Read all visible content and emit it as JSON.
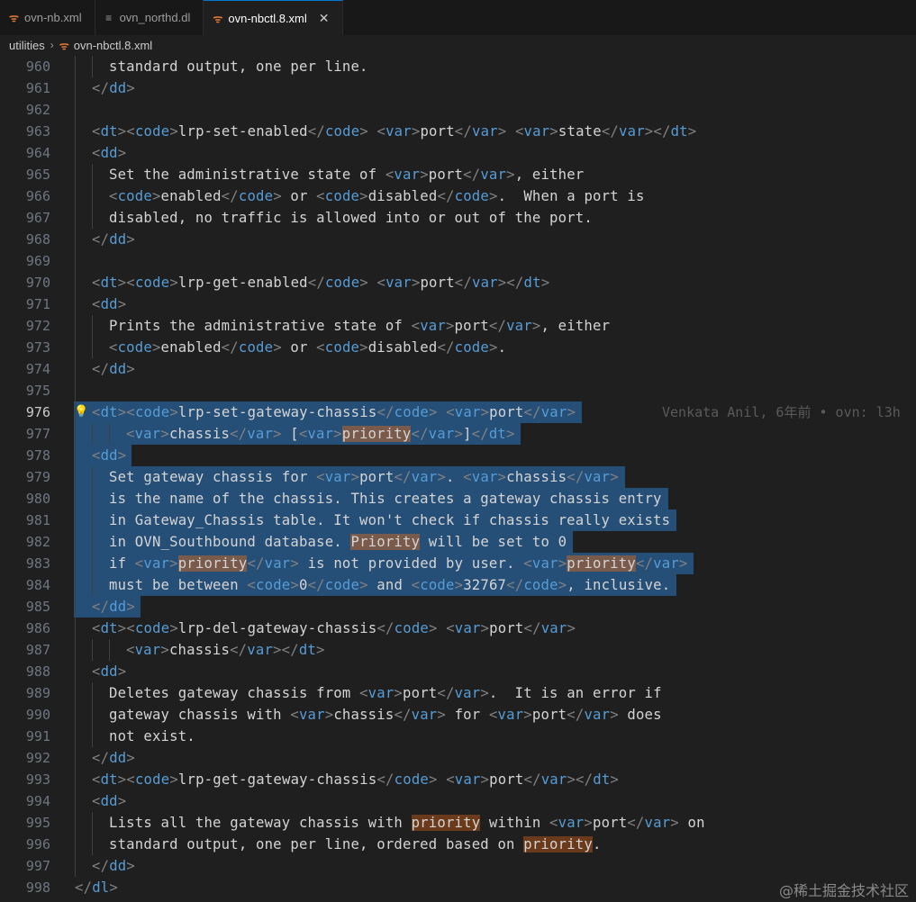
{
  "tabs": [
    {
      "label": "ovn-nb.xml",
      "icon": "rss-icon",
      "active": false
    },
    {
      "label": "ovn_northd.dl",
      "icon": "lines-icon",
      "active": false
    },
    {
      "label": "ovn-nbctl.8.xml",
      "icon": "rss-icon",
      "active": true
    }
  ],
  "breadcrumb": {
    "folder": "utilities",
    "file": "ovn-nbctl.8.xml"
  },
  "blame": "Venkata Anil, 6年前 • ovn: l3h",
  "watermark": "@稀土掘金技术社区",
  "lines": [
    {
      "n": "960",
      "text": "standard output, one per line."
    },
    {
      "n": "961",
      "text": "</dd>"
    },
    {
      "n": "962",
      "text": ""
    },
    {
      "n": "963",
      "text": "<dt><code>lrp-set-enabled</code> <var>port</var> <var>state</var></dt>"
    },
    {
      "n": "964",
      "text": "<dd>"
    },
    {
      "n": "965",
      "text": "Set the administrative state of <var>port</var>, either"
    },
    {
      "n": "966",
      "text": "<code>enabled</code> or <code>disabled</code>.  When a port is"
    },
    {
      "n": "967",
      "text": "disabled, no traffic is allowed into or out of the port."
    },
    {
      "n": "968",
      "text": "</dd>"
    },
    {
      "n": "969",
      "text": ""
    },
    {
      "n": "970",
      "text": "<dt><code>lrp-get-enabled</code> <var>port</var></dt>"
    },
    {
      "n": "971",
      "text": "<dd>"
    },
    {
      "n": "972",
      "text": "Prints the administrative state of <var>port</var>, either"
    },
    {
      "n": "973",
      "text": "<code>enabled</code> or <code>disabled</code>."
    },
    {
      "n": "974",
      "text": "</dd>"
    },
    {
      "n": "975",
      "text": ""
    },
    {
      "n": "976",
      "text": "<dt><code>lrp-set-gateway-chassis</code> <var>port</var>"
    },
    {
      "n": "977",
      "text": "<var>chassis</var> [<var>priority</var>]</dt>"
    },
    {
      "n": "978",
      "text": "<dd>"
    },
    {
      "n": "979",
      "text": "Set gateway chassis for <var>port</var>. <var>chassis</var>"
    },
    {
      "n": "980",
      "text": "is the name of the chassis. This creates a gateway chassis entry"
    },
    {
      "n": "981",
      "text": "in Gateway_Chassis table. It won't check if chassis really exists"
    },
    {
      "n": "982",
      "text": "in OVN_Southbound database. Priority will be set to 0"
    },
    {
      "n": "983",
      "text": "if <var>priority</var> is not provided by user. <var>priority</var>"
    },
    {
      "n": "984",
      "text": "must be between <code>0</code> and <code>32767</code>, inclusive."
    },
    {
      "n": "985",
      "text": "</dd>"
    },
    {
      "n": "986",
      "text": "<dt><code>lrp-del-gateway-chassis</code> <var>port</var>"
    },
    {
      "n": "987",
      "text": "<var>chassis</var></dt>"
    },
    {
      "n": "988",
      "text": "<dd>"
    },
    {
      "n": "989",
      "text": "Deletes gateway chassis from <var>port</var>.  It is an error if"
    },
    {
      "n": "990",
      "text": "gateway chassis with <var>chassis</var> for <var>port</var> does"
    },
    {
      "n": "991",
      "text": "not exist."
    },
    {
      "n": "992",
      "text": "</dd>"
    },
    {
      "n": "993",
      "text": "<dt><code>lrp-get-gateway-chassis</code> <var>port</var></dt>"
    },
    {
      "n": "994",
      "text": "<dd>"
    },
    {
      "n": "995",
      "text": "Lists all the gateway chassis with priority within <var>port</var> on"
    },
    {
      "n": "996",
      "text": "standard output, one per line, ordered based on priority."
    },
    {
      "n": "997",
      "text": "</dd>"
    },
    {
      "n": "998",
      "text": "</dl>"
    }
  ]
}
